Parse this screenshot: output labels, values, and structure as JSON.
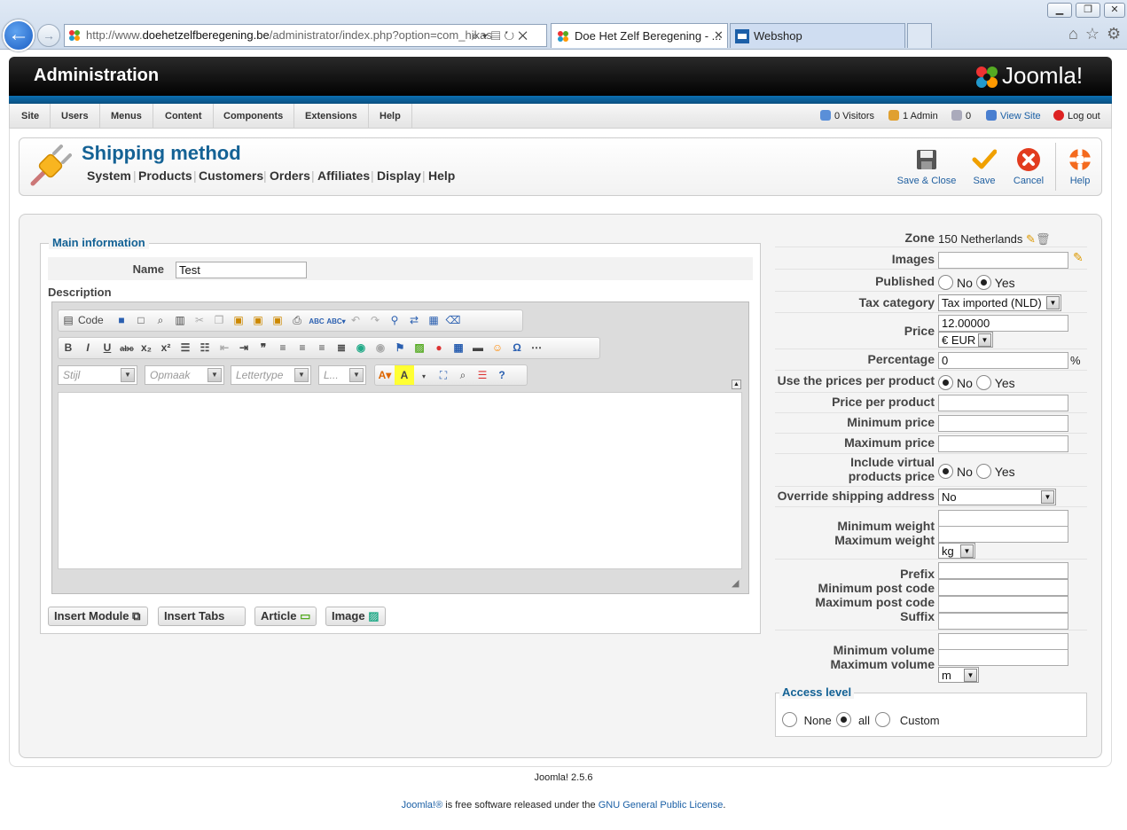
{
  "browser": {
    "address_prefix": "http://www.",
    "address_host": "doehetzelfberegening.be",
    "address_rest": "/administrator/index.php?option=com_hikas",
    "tabs": [
      {
        "label": "Doe Het Zelf Beregening - ..."
      },
      {
        "label": "Webshop"
      }
    ]
  },
  "header": {
    "title": "Administration",
    "logo_text": "Joomla!"
  },
  "menu": {
    "items": [
      "Site",
      "Users",
      "Menus",
      "Content",
      "Components",
      "Extensions",
      "Help"
    ],
    "visitors": "0 Visitors",
    "admins": "1 Admin",
    "messages": "0",
    "view_site": "View Site",
    "logout": "Log out"
  },
  "toolbar": {
    "title": "Shipping method",
    "submenu": [
      "System",
      "Products",
      "Customers",
      "Orders",
      "Affiliates",
      "Display",
      "Help"
    ],
    "buttons": {
      "save_close": "Save & Close",
      "save": "Save",
      "cancel": "Cancel",
      "help": "Help"
    }
  },
  "main_info": {
    "legend": "Main information",
    "name_label": "Name",
    "name_value": "Test",
    "description_label": "Description",
    "editor": {
      "code_label": "Code",
      "combos": [
        "Stijl",
        "Opmaak",
        "Lettertype",
        "L..."
      ]
    },
    "buttons": [
      "Insert Module",
      "Insert Tabs",
      "Article",
      "Image"
    ]
  },
  "settings": {
    "zone_label": "Zone",
    "zone_value": "150 Netherlands",
    "images_label": "Images",
    "published_label": "Published",
    "no": "No",
    "yes": "Yes",
    "tax_label": "Tax category",
    "tax_value": "Tax imported (NLD)",
    "price_label": "Price",
    "price_value": "12.00000",
    "currency": "€ EUR",
    "percentage_label": "Percentage",
    "percentage_value": "0",
    "percent_sign": "%",
    "use_prices_label": "Use the prices per product",
    "price_per_product_label": "Price per product",
    "min_price_label": "Minimum price",
    "max_price_label": "Maximum price",
    "virtual_label_1": "Include virtual",
    "virtual_label_2": "products price",
    "override_label": "Override shipping address",
    "override_value": "No",
    "min_weight_label": "Minimum weight",
    "max_weight_label": "Maximum weight",
    "weight_unit": "kg",
    "prefix_label": "Prefix",
    "min_post_label": "Minimum post code",
    "max_post_label": "Maximum post code",
    "suffix_label": "Suffix",
    "min_volume_label": "Minimum volume",
    "max_volume_label": "Maximum volume",
    "volume_unit": "m"
  },
  "access": {
    "legend": "Access level",
    "none": "None",
    "all": "all",
    "custom": "Custom"
  },
  "footer": {
    "version": "Joomla! 2.5.6",
    "license_pre": "Joomla!®",
    "license_mid": " is free software released under the ",
    "license_link": "GNU General Public License",
    "license_end": "."
  },
  "colors": {
    "accent": "#146295",
    "link": "#1a5fa5",
    "brand_bar": "#0b6fb2"
  }
}
